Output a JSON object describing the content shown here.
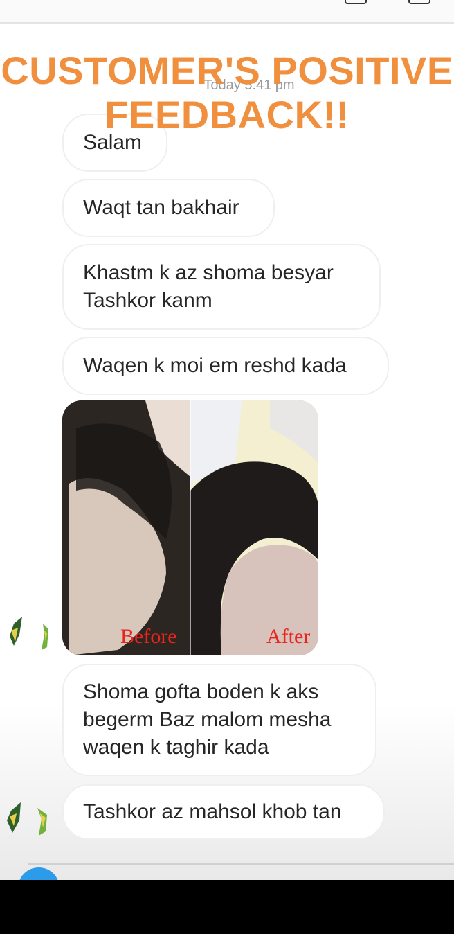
{
  "overlay": {
    "title_line1": "CUSTOMER'S POSITIVE",
    "title_line2": "FEEDBACK!!",
    "color": "#F0903F"
  },
  "chat": {
    "timestamp": "Today 5:41 pm",
    "messages": [
      {
        "text": "Salam"
      },
      {
        "text": "Waqt tan bakhair"
      },
      {
        "text": "Khastm k az shoma besyar Tashkor kanm"
      },
      {
        "text": "Waqen k moi em reshd kada"
      },
      {
        "text": "Shoma gofta boden k aks begerm Baz malom mesha waqen k taghir kada"
      },
      {
        "text": "Tashkor az mahsol khob tan"
      }
    ],
    "photo": {
      "before_label": "Before",
      "after_label": "After"
    }
  }
}
